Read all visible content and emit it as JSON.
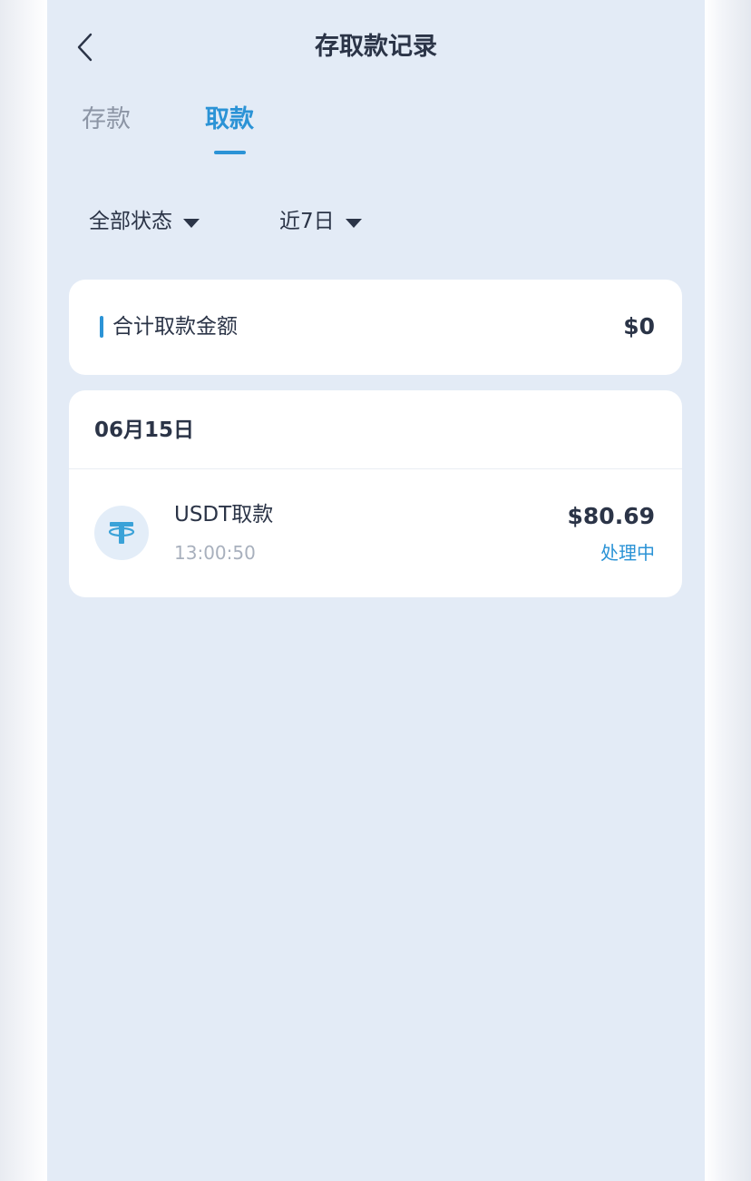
{
  "header": {
    "title": "存取款记录",
    "back_icon": "chevron-left-icon"
  },
  "tabs": [
    {
      "label": "存款",
      "active": false
    },
    {
      "label": "取款",
      "active": true
    }
  ],
  "filters": {
    "status": "全部状态",
    "period": "近7日"
  },
  "total": {
    "label": "合计取款金额",
    "amount": "$0"
  },
  "records": [
    {
      "date": "06月15日",
      "items": [
        {
          "icon": "tether-usdt-icon",
          "title": "USDT取款",
          "time": "13:00:50",
          "amount": "$80.69",
          "status": "处理中"
        }
      ]
    }
  ],
  "colors": {
    "accent": "#2b93d6",
    "background": "#e3ebf6",
    "card": "#ffffff",
    "text": "#2b3447",
    "muted": "#a8b0bd",
    "tether": "#3aa2d8"
  }
}
